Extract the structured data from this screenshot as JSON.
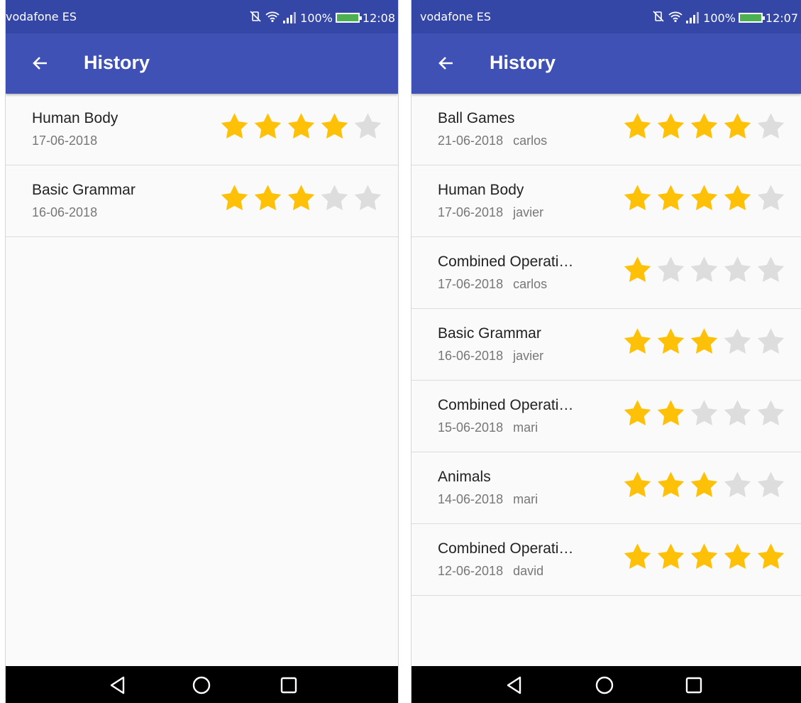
{
  "colors": {
    "app_bar": "#3f51b5",
    "status_bar": "#3547a6",
    "star_filled": "#ffc107",
    "star_empty": "#dddddd"
  },
  "screens": [
    {
      "status": {
        "carrier": "vodafone ES",
        "battery": "100%",
        "time": "12:08"
      },
      "toolbar": {
        "title": "History",
        "back_icon": "arrow-back-icon"
      },
      "history": [
        {
          "title": "Human Body",
          "date": "17-06-2018",
          "user": "",
          "rating": 4,
          "max_rating": 5
        },
        {
          "title": "Basic Grammar",
          "date": "16-06-2018",
          "user": "",
          "rating": 3,
          "max_rating": 5
        }
      ],
      "navbar": {
        "icons": [
          "back-triangle-icon",
          "home-circle-icon",
          "recents-square-icon"
        ]
      }
    },
    {
      "status": {
        "carrier": "vodafone ES",
        "battery": "100%",
        "time": "12:07"
      },
      "toolbar": {
        "title": "History",
        "back_icon": "arrow-back-icon"
      },
      "history": [
        {
          "title": "Ball Games",
          "date": "21-06-2018",
          "user": "carlos",
          "rating": 4,
          "max_rating": 5
        },
        {
          "title": "Human Body",
          "date": "17-06-2018",
          "user": "javier",
          "rating": 4,
          "max_rating": 5
        },
        {
          "title": "Combined Operati…",
          "date": "17-06-2018",
          "user": "carlos",
          "rating": 1,
          "max_rating": 5
        },
        {
          "title": "Basic Grammar",
          "date": "16-06-2018",
          "user": "javier",
          "rating": 3,
          "max_rating": 5
        },
        {
          "title": "Combined Operati…",
          "date": "15-06-2018",
          "user": "mari",
          "rating": 2,
          "max_rating": 5
        },
        {
          "title": "Animals",
          "date": "14-06-2018",
          "user": "mari",
          "rating": 3,
          "max_rating": 5
        },
        {
          "title": "Combined Operati…",
          "date": "12-06-2018",
          "user": "david",
          "rating": 5,
          "max_rating": 5
        }
      ],
      "navbar": {
        "icons": [
          "back-triangle-icon",
          "home-circle-icon",
          "recents-square-icon"
        ]
      }
    }
  ]
}
